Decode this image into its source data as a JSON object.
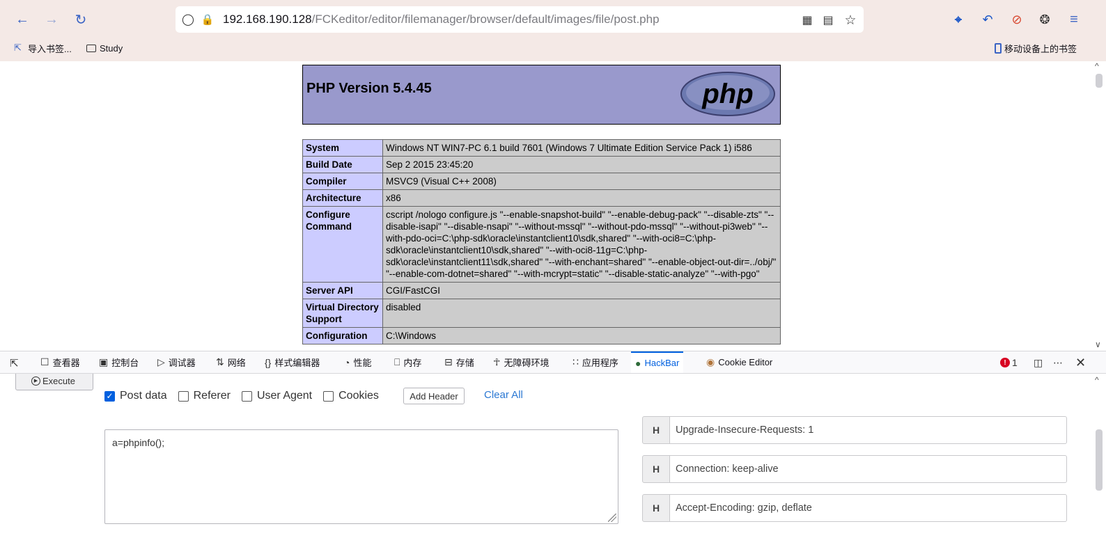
{
  "browser": {
    "url_host": "192.168.190.128",
    "url_path": "/FCKeditor/editor/filemanager/browser/default/images/file/post.php",
    "bookmarks": [
      {
        "label": "导入书签..."
      },
      {
        "label": "Study"
      }
    ],
    "mobile_bookmarks": "移动设备上的书签"
  },
  "phpinfo": {
    "title": "PHP Version 5.4.45",
    "logo_text": "php",
    "rows": [
      {
        "key": "System",
        "value": "Windows NT WIN7-PC 6.1 build 7601 (Windows 7 Ultimate Edition Service Pack 1) i586"
      },
      {
        "key": "Build Date",
        "value": "Sep 2 2015 23:45:20"
      },
      {
        "key": "Compiler",
        "value": "MSVC9 (Visual C++ 2008)"
      },
      {
        "key": "Architecture",
        "value": "x86"
      },
      {
        "key": "Configure Command",
        "value": "cscript /nologo configure.js \"--enable-snapshot-build\" \"--enable-debug-pack\" \"--disable-zts\" \"--disable-isapi\" \"--disable-nsapi\" \"--without-mssql\" \"--without-pdo-mssql\" \"--without-pi3web\" \"--with-pdo-oci=C:\\php-sdk\\oracle\\instantclient10\\sdk,shared\" \"--with-oci8=C:\\php-sdk\\oracle\\instantclient10\\sdk,shared\" \"--with-oci8-11g=C:\\php-sdk\\oracle\\instantclient11\\sdk,shared\" \"--with-enchant=shared\" \"--enable-object-out-dir=../obj/\" \"--enable-com-dotnet=shared\" \"--with-mcrypt=static\" \"--disable-static-analyze\" \"--with-pgo\""
      },
      {
        "key": "Server API",
        "value": "CGI/FastCGI"
      },
      {
        "key": "Virtual Directory Support",
        "value": "disabled"
      },
      {
        "key": "Configuration",
        "value": "C:\\Windows"
      }
    ]
  },
  "devtools": {
    "tabs": [
      {
        "label": "查看器",
        "icon": "inspector-icon"
      },
      {
        "label": "控制台",
        "icon": "console-icon"
      },
      {
        "label": "调试器",
        "icon": "debugger-icon"
      },
      {
        "label": "网络",
        "icon": "network-icon"
      },
      {
        "label": "样式编辑器",
        "icon": "style-editor-icon"
      },
      {
        "label": "性能",
        "icon": "performance-icon"
      },
      {
        "label": "内存",
        "icon": "memory-icon"
      },
      {
        "label": "存储",
        "icon": "storage-icon"
      },
      {
        "label": "无障碍环境",
        "icon": "accessibility-icon"
      },
      {
        "label": "应用程序",
        "icon": "application-icon"
      },
      {
        "label": "HackBar",
        "icon": "hackbar-icon"
      },
      {
        "label": "Cookie Editor",
        "icon": "cookie-editor-icon"
      }
    ],
    "active_tab": "HackBar",
    "error_count": "1"
  },
  "hackbar": {
    "execute_label": "Execute",
    "options": [
      {
        "label": "Post data",
        "checked": true
      },
      {
        "label": "Referer",
        "checked": false
      },
      {
        "label": "User Agent",
        "checked": false
      },
      {
        "label": "Cookies",
        "checked": false
      }
    ],
    "add_header_label": "Add Header",
    "clear_all_label": "Clear All",
    "post_body": "a=phpinfo();",
    "headers": [
      {
        "tag": "H",
        "value": "Upgrade-Insecure-Requests: 1"
      },
      {
        "tag": "H",
        "value": "Connection: keep-alive"
      },
      {
        "tag": "H",
        "value": "Accept-Encoding: gzip, deflate"
      }
    ]
  },
  "colors": {
    "php_header_bg": "#9999cc",
    "php_key_bg": "#ccccff",
    "php_value_bg": "#cccccc",
    "accent": "#0060df",
    "chrome_bg": "#f4e9e6"
  }
}
